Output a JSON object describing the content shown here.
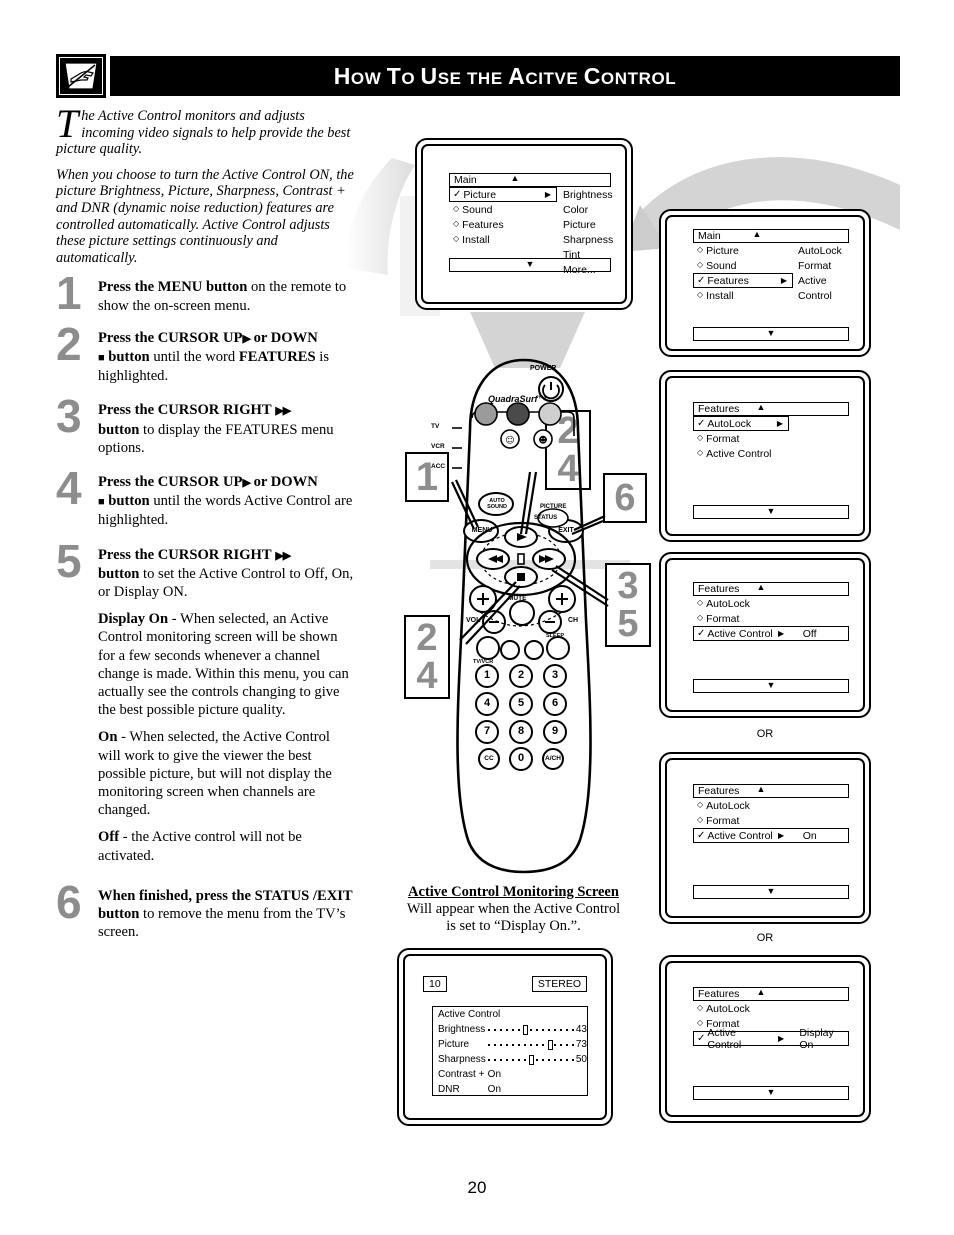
{
  "header": {
    "icon": "tv-hand-icon",
    "title_parts": [
      {
        "t": "H",
        "big": true
      },
      {
        "t": "OW",
        "big": false
      },
      {
        "t": " ",
        "big": false
      },
      {
        "t": "T",
        "big": true
      },
      {
        "t": "O ",
        "big": false
      },
      {
        "t": "U",
        "big": true
      },
      {
        "t": "SE",
        "big": false
      },
      {
        "t": " ",
        "big": false
      },
      {
        "t": "THE",
        "big": false
      },
      {
        "t": " ",
        "big": false
      },
      {
        "t": "A",
        "big": true
      },
      {
        "t": "CITVE",
        "big": false
      },
      {
        "t": " ",
        "big": false
      },
      {
        "t": "C",
        "big": true
      },
      {
        "t": "ONTROL",
        "big": false
      }
    ],
    "title_plain": "How to Use the Acitve Control"
  },
  "intro": {
    "p1_dropcap": "T",
    "p1": "he Active Control monitors and adjusts incoming video signals to help provide the best picture quality.",
    "p2": "When you choose to turn the Active Control ON, the picture Brightness, Picture, Sharpness, Contrast + and DNR (dynamic noise reduction) features are controlled automatically. Active Control adjusts these picture settings continuously and automatically."
  },
  "steps": [
    {
      "num": "1",
      "bold1": "Press the MENU button",
      "rest": " on the remote to show the on-screen menu."
    },
    {
      "num": "2",
      "bold1": "Press the CURSOR UP",
      "glyph1": "▶",
      "bold1b": " or DOWN",
      "glyph2": "■",
      "bold2": " button",
      "rest": " until the word ",
      "boldword": "FEATURES",
      "rest2": " is highlighted."
    },
    {
      "num": "3",
      "bold1": "Press the CURSOR RIGHT",
      "glyph1": "▶▶",
      "bold2": "button",
      "rest": " to display the FEATURES menu options."
    },
    {
      "num": "4",
      "bold1": "Press the CURSOR UP",
      "glyph1": "▶",
      "bold1b": " or DOWN",
      "glyph2": "■",
      "bold2": " button",
      "rest": " until the words Active Control are highlighted."
    },
    {
      "num": "5",
      "bold1": "Press the CURSOR RIGHT",
      "glyph1": "▶▶",
      "bold2": "button",
      "rest": " to set the Active Control to Off, On, or Display ON."
    },
    {
      "num": "6",
      "bold1": "When finished, press the STATUS /EXIT button",
      "rest": " to remove the menu from the TV’s screen."
    }
  ],
  "option_paragraphs": [
    {
      "term": "Display On",
      "text": " - When selected, an Active Control monitoring screen will be shown for a few seconds whenever a channel change is made. Within this menu, you can actually see the controls changing to give the best possible picture quality."
    },
    {
      "term": "On",
      "text": " - When selected, the Active Control will work to give the viewer the best possible picture, but will not display the monitoring screen when channels are changed."
    },
    {
      "term": "Off",
      "text": " - the Active control will not be activated."
    }
  ],
  "osd_screens": {
    "main_picture": {
      "header": "Main",
      "up_arrow": "▲",
      "down_arrow": "▼",
      "rows": [
        {
          "label": "Picture",
          "selected": true,
          "marker": "check",
          "arrow": "▶"
        },
        {
          "label": "Sound",
          "selected": false,
          "marker": "diamond"
        },
        {
          "label": "Features",
          "selected": false,
          "marker": "diamond"
        },
        {
          "label": "Install",
          "selected": false,
          "marker": "diamond"
        }
      ],
      "column2": [
        "Brightness",
        "Color",
        "Picture",
        "Sharpness",
        "Tint",
        "More..."
      ]
    },
    "main_features": {
      "header": "Main",
      "up_arrow": "▲",
      "down_arrow": "▼",
      "rows": [
        {
          "label": "Picture",
          "selected": false,
          "marker": "diamond"
        },
        {
          "label": "Sound",
          "selected": false,
          "marker": "diamond"
        },
        {
          "label": "Features",
          "selected": true,
          "marker": "check",
          "arrow": "▶"
        },
        {
          "label": "Install",
          "selected": false,
          "marker": "diamond"
        }
      ],
      "column2": [
        "AutoLock",
        "Format",
        "Active Control"
      ]
    },
    "features_autolock": {
      "header": "Features",
      "up_arrow": "▲",
      "down_arrow": "▼",
      "rows": [
        {
          "label": "AutoLock",
          "selected": true,
          "marker": "check",
          "arrow": "▶"
        },
        {
          "label": "Format",
          "selected": false,
          "marker": "diamond"
        },
        {
          "label": "Active Control",
          "selected": false,
          "marker": "diamond"
        }
      ]
    },
    "features_off": {
      "header": "Features",
      "up_arrow": "▲",
      "down_arrow": "▼",
      "rows": [
        {
          "label": "AutoLock",
          "selected": false,
          "marker": "diamond"
        },
        {
          "label": "Format",
          "selected": false,
          "marker": "diamond"
        },
        {
          "label": "Active Control",
          "selected": true,
          "marker": "check",
          "arrow": "▶",
          "value": "Off"
        }
      ]
    },
    "features_on": {
      "header": "Features",
      "up_arrow": "▲",
      "down_arrow": "▼",
      "rows": [
        {
          "label": "AutoLock",
          "selected": false,
          "marker": "diamond"
        },
        {
          "label": "Format",
          "selected": false,
          "marker": "diamond"
        },
        {
          "label": "Active Control",
          "selected": true,
          "marker": "check",
          "arrow": "▶",
          "value": "On"
        }
      ]
    },
    "features_display_on": {
      "header": "Features",
      "up_arrow": "▲",
      "down_arrow": "▼",
      "rows": [
        {
          "label": "AutoLock",
          "selected": false,
          "marker": "diamond"
        },
        {
          "label": "Format",
          "selected": false,
          "marker": "diamond"
        },
        {
          "label": "Active Control",
          "selected": true,
          "marker": "check",
          "arrow": "▶",
          "value": "Display On"
        }
      ]
    }
  },
  "or_labels": {
    "or1": "OR",
    "or2": "OR"
  },
  "monitoring": {
    "caption_title": "Active Control Monitoring Screen",
    "caption_line1": "Will appear when the Active Control",
    "caption_line2": "is set to “Display On.”.",
    "channel": "10",
    "stereo": "STEREO",
    "box_title": "Active Control",
    "rows": [
      {
        "name": "Brightness",
        "value": "43",
        "pct": 43,
        "gauge": true
      },
      {
        "name": "Picture",
        "value": "73",
        "pct": 73,
        "gauge": true
      },
      {
        "name": "Sharpness",
        "value": "50",
        "pct": 50,
        "gauge": true
      },
      {
        "name": "Contrast +",
        "value": "On",
        "gauge": false
      },
      {
        "name": "DNR",
        "value": "On",
        "gauge": false
      }
    ]
  },
  "remote": {
    "power_label": "POWER",
    "quadrasurf_label": "QuadraSurf™",
    "source_labels": [
      "TV",
      "VCR",
      "ACC"
    ],
    "auto_sound_label": "AUTO SOUND",
    "menu_label": "MENU",
    "exit_label": "EXIT",
    "status_label": "STATUS",
    "picture_label": "PICTURE",
    "mute_label": "MUTE",
    "vol_label": "VOL",
    "ch_label": "CH",
    "sleep_label": "SLEEP",
    "tvvcr_label": "TV/VCR",
    "keypad": [
      "1",
      "2",
      "3",
      "4",
      "5",
      "6",
      "7",
      "8",
      "9",
      "CC",
      "0",
      "A/CH"
    ],
    "cursor_up": "▶",
    "cursor_down": "■",
    "cursor_left": "◀◀",
    "cursor_right": "▶▶"
  },
  "callouts": [
    {
      "id": "callout-1",
      "text": "1"
    },
    {
      "id": "callout-24-top",
      "line1": "2",
      "line2": "4"
    },
    {
      "id": "callout-6",
      "text": "6"
    },
    {
      "id": "callout-35",
      "line1": "3",
      "line2": "5"
    },
    {
      "id": "callout-24-bottom",
      "line1": "2",
      "line2": "4"
    }
  ],
  "page_number": "20",
  "colors": {
    "header_bg": "#000000",
    "step_number": "#8d8d8d",
    "ribbon_gray": "#d2d2d2"
  }
}
